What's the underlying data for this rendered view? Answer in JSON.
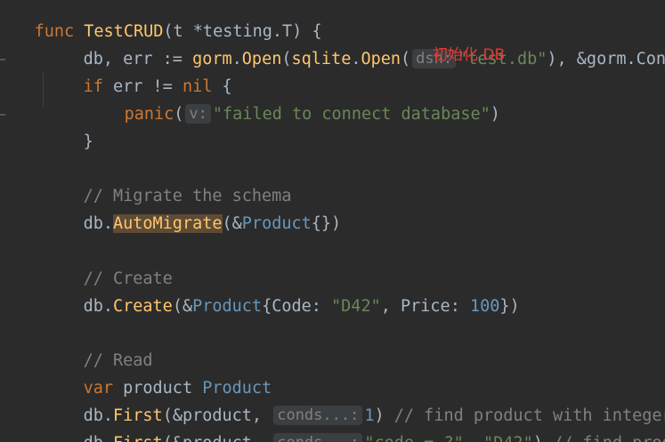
{
  "code": {
    "line1_prefix": "func ",
    "line1_name": "TestCRUD",
    "line1_rest": "(t *testing.T) {",
    "line2_db": "db, err := ",
    "line2_gorm": "gorm",
    "line2_open": "Open",
    "line2_sqlite": "sqlite",
    "line2_open2": "Open",
    "line2_hint": "dsn:",
    "line2_str": "\"test.db\"",
    "line2_tail": "), &gorm.Confi",
    "line3_if": "if",
    "line3_err": " err != ",
    "line3_nil": "nil",
    "line3_brace": " {",
    "line4_panic": "panic",
    "line4_hint": "v:",
    "line4_str": "\"failed to connect database\"",
    "line4_close": ")",
    "line5_brace": "}",
    "line7_comment": "// Migrate the schema",
    "line8_db": "db.",
    "line8_method": "AutoMigrate",
    "line8_amp": "(&",
    "line8_type": "Product",
    "line8_tail": "{})",
    "line10_comment": "// Create",
    "line11_db": "db.",
    "line11_method": "Create",
    "line11_amp": "(&",
    "line11_type": "Product",
    "line11_open": "{Code: ",
    "line11_str": "\"D42\"",
    "line11_mid": ", Price: ",
    "line11_num": "100",
    "line11_tail": "})",
    "line13_comment": "// Read",
    "line14_var": "var",
    "line14_id": " product ",
    "line14_type": "Product",
    "line15_db": "db.",
    "line15_method": "First",
    "line15_amp": "(&product, ",
    "line15_hint": "conds...:",
    "line15_num": "1",
    "line15_tail": ") ",
    "line15_comment": "// find product with integer p",
    "line16_db": "db.",
    "line16_method": "First",
    "line16_amp": "(&product, ",
    "line16_hint": "conds...:",
    "line16_str1": "\"code = ?\"",
    "line16_comma": ", ",
    "line16_str2": "\"D42\"",
    "line16_tail": ") ",
    "line16_comment": "// find produc"
  },
  "annotation": {
    "text": "初始化 DB",
    "color": "#e53935"
  },
  "colors": {
    "background": "#2b2b2b",
    "keyword": "#cc7832",
    "function": "#ffc66d",
    "string": "#6a8759",
    "number": "#6897bb",
    "comment": "#808080",
    "text": "#a9b7c6"
  }
}
